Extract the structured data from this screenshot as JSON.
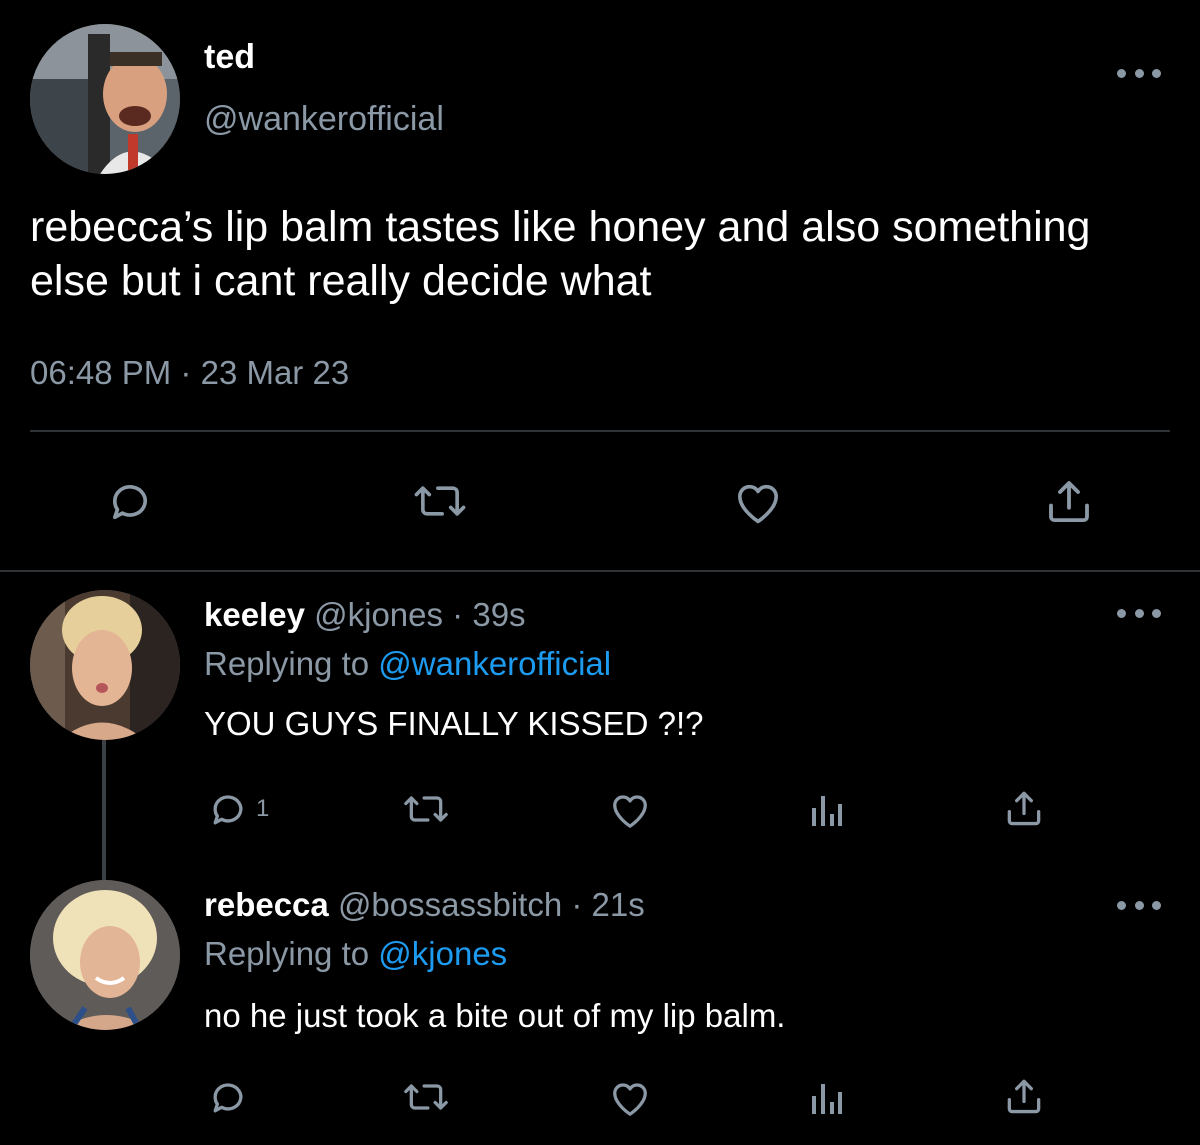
{
  "main_tweet": {
    "name": "ted",
    "handle": "@wankerofficial",
    "text": "rebecca’s lip balm tastes like honey and also something else but i cant really decide what",
    "time": "06:48 PM",
    "separator": "·",
    "date": "23 Mar 23",
    "avatar_icon": "avatar-photo-man-smiling",
    "actions": [
      "reply-icon",
      "retweet-icon",
      "like-icon",
      "share-icon"
    ]
  },
  "replies": [
    {
      "name": "keeley",
      "handle": "@kjones",
      "separator": "·",
      "age": "39s",
      "replying_prefix": "Replying to",
      "replying_to": "@wankerofficial",
      "text": "YOU GUYS FINALLY KISSED ?!?",
      "reply_count": "1",
      "avatar_icon": "avatar-photo-woman-kiss-face",
      "actions": [
        "reply-icon",
        "retweet-icon",
        "like-icon",
        "analytics-icon",
        "share-icon"
      ]
    },
    {
      "name": "rebecca",
      "handle": "@bossassbitch",
      "separator": "·",
      "age": "21s",
      "replying_prefix": "Replying to",
      "replying_to": "@kjones",
      "text": "no he just took a bite out of my lip balm.",
      "reply_count": "",
      "avatar_icon": "avatar-photo-blonde-woman",
      "actions": [
        "reply-icon",
        "retweet-icon",
        "like-icon",
        "analytics-icon",
        "share-icon"
      ]
    }
  ],
  "colors": {
    "background": "#000000",
    "text_primary": "#ffffff",
    "text_secondary": "#8b98a5",
    "link": "#1d9bf0",
    "divider": "#2f3336"
  }
}
